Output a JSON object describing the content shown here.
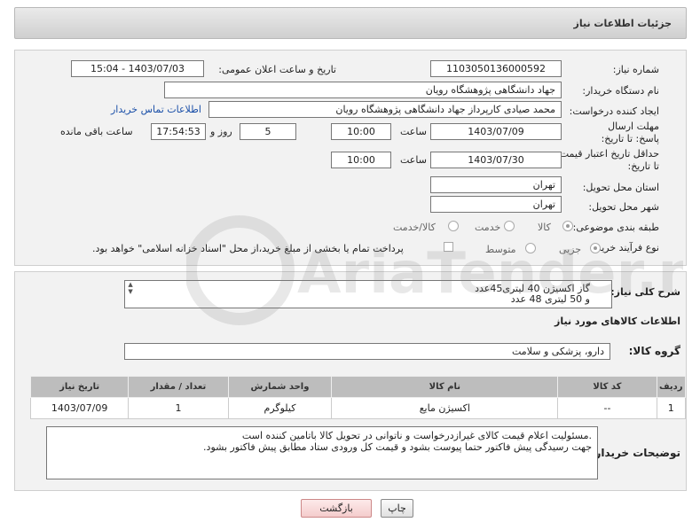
{
  "header": {
    "title": "جزئیات اطلاعات نیاز"
  },
  "fields": {
    "need_number_label": "شماره نیاز:",
    "need_number": "1103050136000592",
    "announce_label": "تاریخ و ساعت اعلان عمومی:",
    "announce_value": "1403/07/03 - 15:04",
    "buyer_label": "نام دستگاه خریدار:",
    "buyer_value": "جهاد دانشگاهی پژوهشگاه رویان",
    "creator_label": "ایجاد کننده درخواست:",
    "creator_value": "محمد صیادی کارپرداز جهاد دانشگاهی پژوهشگاه رویان",
    "contact_link": "اطلاعات تماس خریدار",
    "deadline_label": "مهلت ارسال پاسخ: تا تاریخ:",
    "deadline_date": "1403/07/09",
    "time_label": "ساعت",
    "deadline_time": "10:00",
    "days_value": "5",
    "days_label": "روز و",
    "remaining_time": "17:54:53",
    "remaining_label": "ساعت باقی مانده",
    "validity_label": "حداقل تاریخ اعتبار قیمت: تا تاریخ:",
    "validity_date": "1403/07/30",
    "validity_time": "10:00",
    "province_label": "استان محل تحویل:",
    "province_value": "تهران",
    "city_label": "شهر محل تحویل:",
    "city_value": "تهران",
    "category_label": "طبقه بندی موضوعی:",
    "category_options": [
      "کالا",
      "خدمت",
      "کالا/خدمت"
    ],
    "process_label": "نوع فرآیند خرید :",
    "process_options": [
      "جزیی",
      "متوسط"
    ],
    "payment_note": "پرداخت تمام یا بخشی از مبلغ خرید،از محل \"اسناد خزانه اسلامی\" خواهد بود."
  },
  "description": {
    "label": "شرح کلی نیاز:",
    "lines": [
      "گاز اکسیژن 40 لیتری45عدد",
      "و 50 لیتری 48 عدد"
    ]
  },
  "goods": {
    "section_title": "اطلاعات کالاهای مورد نیاز",
    "group_label": "گروه کالا:",
    "group_value": "دارو، پزشکی و سلامت",
    "columns": [
      "ردیف",
      "کد کالا",
      "نام کالا",
      "واحد شمارش",
      "تعداد / مقدار",
      "تاریخ نیاز"
    ],
    "rows": [
      [
        "1",
        "--",
        "اکسیژن مایع",
        "کیلوگرم",
        "1",
        "1403/07/09"
      ]
    ]
  },
  "buyer_notes": {
    "label": "توضیحات خریدار:",
    "lines": [
      ".مسئولیت اعلام قیمت کالای غیرازدرخواست و ناتوانی در تحویل کالا باتامین کننده است",
      "جهت رسیدگی پیش فاکتور حتما پیوست بشود و قیمت کل ورودی ستاد مطابق پیش فاکتور بشود."
    ]
  },
  "buttons": {
    "print": "چاپ",
    "back": "بازگشت"
  },
  "watermark": {
    "text": "AriaTender.neT"
  }
}
